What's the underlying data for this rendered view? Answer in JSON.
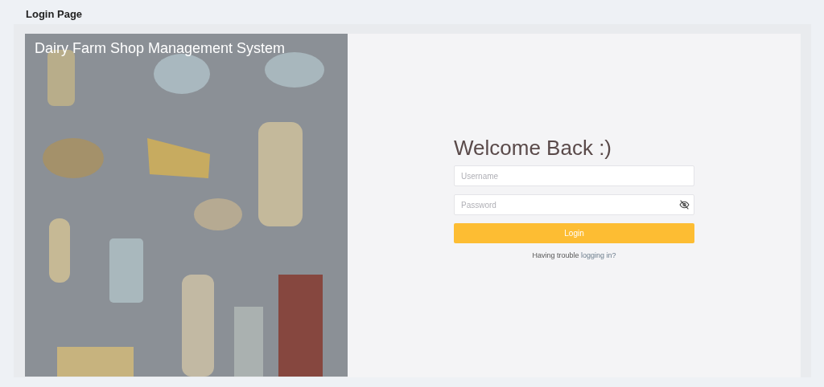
{
  "page_title": "Login Page",
  "banner": {
    "kind": "picture",
    "title": "Dairy Farm Shop Management System"
  },
  "form": {
    "heading": "Welcome Back :)",
    "username": {
      "placeholder": "Username"
    },
    "password": {
      "placeholder": "Password"
    },
    "login_button": "Login",
    "help": {
      "text": "Having trouble",
      "link": "logging in?"
    }
  }
}
